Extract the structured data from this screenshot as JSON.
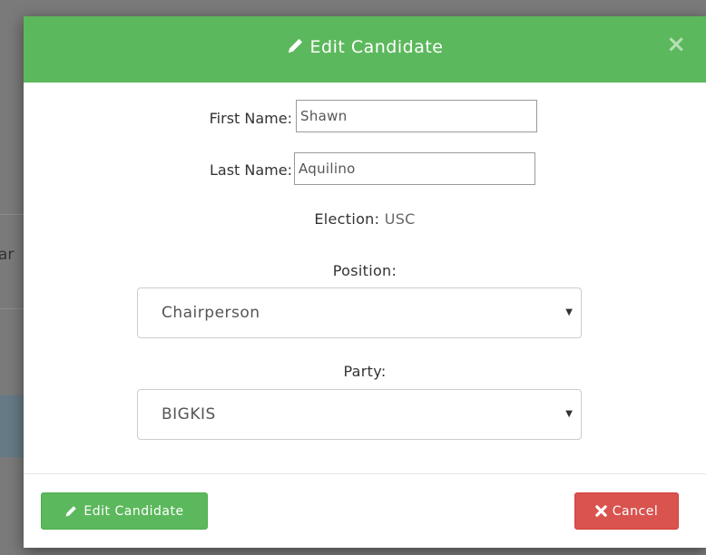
{
  "background": {
    "partial_text": "ar"
  },
  "modal": {
    "title": "Edit Candidate",
    "close_glyph": "×",
    "first_name": {
      "label": "First Name:",
      "value": "Shawn"
    },
    "last_name": {
      "label": "Last Name:",
      "value": "Aquilino"
    },
    "election": {
      "label": "Election:",
      "value": "USC"
    },
    "position": {
      "label": "Position:",
      "selected": "Chairperson"
    },
    "party": {
      "label": "Party:",
      "selected": "BIGKIS"
    },
    "footer": {
      "edit_label": "Edit Candidate",
      "cancel_label": "Cancel"
    }
  },
  "colors": {
    "header_green": "#5cb85c",
    "edit_green": "#5cb85c",
    "cancel_red": "#d9534f"
  },
  "icons": {
    "title": "pencil-icon",
    "close": "close-icon",
    "edit_button": "pencil-icon",
    "cancel_button": "x-mark-icon",
    "dropdown": "caret-down-icon"
  }
}
